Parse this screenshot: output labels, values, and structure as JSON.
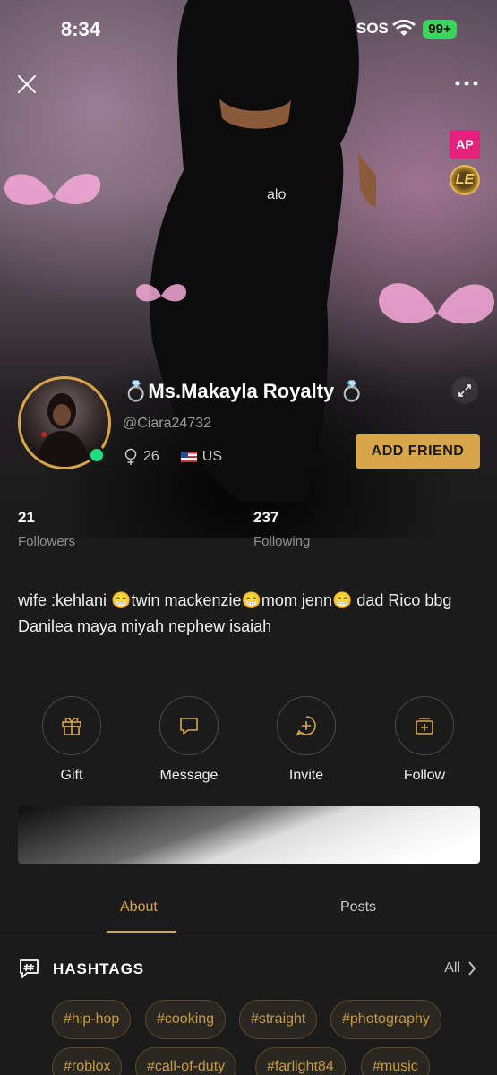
{
  "status_bar": {
    "time": "8:34",
    "sos": "SOS",
    "battery": "99+"
  },
  "badges": {
    "ap": "AP",
    "le": "LE"
  },
  "profile": {
    "name": "💍Ms.Makayla Royalty 💍",
    "handle": "@Ciara24732",
    "age": "26",
    "country": "US",
    "add_friend_label": "ADD FRIEND"
  },
  "stats": {
    "followers": {
      "count": "21",
      "label": "Followers"
    },
    "following": {
      "count": "237",
      "label": "Following"
    }
  },
  "bio": "wife :kehlani 😁twin mackenzie😁mom jenn😁 dad Rico bbg Danilea maya miyah nephew isaiah",
  "actions": [
    {
      "label": "Gift",
      "icon": "gift-icon"
    },
    {
      "label": "Message",
      "icon": "message-icon"
    },
    {
      "label": "Invite",
      "icon": "invite-icon"
    },
    {
      "label": "Follow",
      "icon": "follow-icon"
    }
  ],
  "tabs": [
    {
      "label": "About",
      "active": true
    },
    {
      "label": "Posts",
      "active": false
    }
  ],
  "hashtags": {
    "title": "HASHTAGS",
    "all_label": "All",
    "tags": [
      "#hip-hop",
      "#cooking",
      "#straight",
      "#photography",
      "#roblox",
      "#call-of-duty",
      "#farlight84",
      "#music"
    ]
  },
  "colors": {
    "accent": "#d8a648",
    "online": "#1ee07a",
    "ap_badge": "#e2227c"
  }
}
